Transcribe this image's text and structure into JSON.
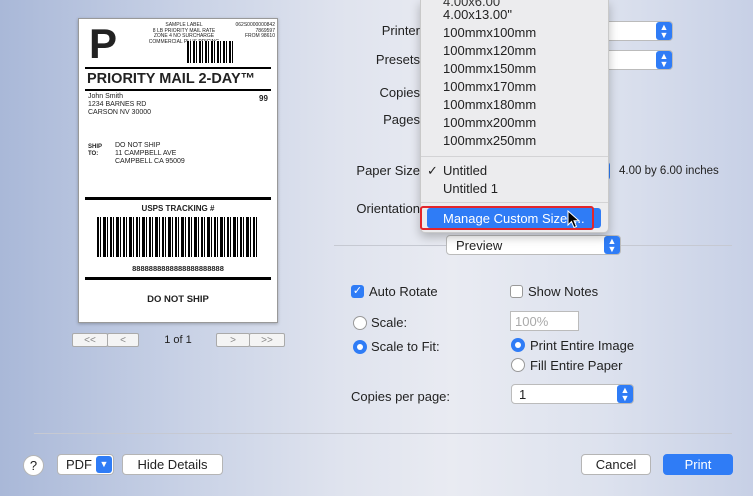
{
  "preview_label": {
    "logo_letter": "P",
    "sample_block": "SAMPLE LABEL\n8 LB PRIORITY MAIL RATE\nZONE 4 NO SURCHARGE\nCOMMERCIAL PLUS PRICING",
    "right_block": "062S0000000842\n7869597\nFROM 98610",
    "service_title": "PRIORITY MAIL 2-DAY™",
    "from_address": "John Smith\n1234 BARNES RD\nCARSON NV 30000",
    "code": "99",
    "ship_to_label": "SHIP\nTO:",
    "to_address": "DO NOT SHIP\n11 CAMPBELL AVE\nCAMPBELL CA 95009",
    "tracking_title": "USPS TRACKING #",
    "tracking_number": "8888888888888888888888",
    "footer": "DO NOT SHIP"
  },
  "pager": {
    "first": "<<",
    "prev": "<",
    "next": ">",
    "last": ">>",
    "page_text": "1 of 1"
  },
  "form": {
    "printer_label": "Printer",
    "presets_label": "Presets",
    "copies_label": "Copies",
    "pages_label": "Pages",
    "paper_size_label": "Paper Size",
    "paper_size_dims": "4.00 by 6.00 inches",
    "orientation_label": "Orientation",
    "section_popup": "Preview"
  },
  "options": {
    "auto_rotate": "Auto Rotate",
    "show_notes": "Show Notes",
    "scale": "Scale:",
    "scale_value": "100%",
    "scale_to_fit": "Scale to Fit:",
    "print_entire_image": "Print Entire Image",
    "fill_entire_paper": "Fill Entire Paper",
    "copies_per_page_label": "Copies per page:",
    "copies_per_page_value": "1"
  },
  "paper_menu": {
    "top_items": [
      "4.00x13.00\"",
      "100mmx100mm",
      "100mmx120mm",
      "100mmx150mm",
      "100mmx170mm",
      "100mmx180mm",
      "100mmx200mm",
      "100mmx250mm"
    ],
    "checked_item": "Untitled",
    "second_item": "Untitled 1",
    "manage_item": "Manage Custom Sizes..."
  },
  "footer": {
    "help": "?",
    "pdf": "PDF",
    "hide_details": "Hide Details",
    "cancel": "Cancel",
    "print": "Print"
  },
  "colors": {
    "accent": "#2f7cf6",
    "highlight_box": "#e3262b"
  }
}
